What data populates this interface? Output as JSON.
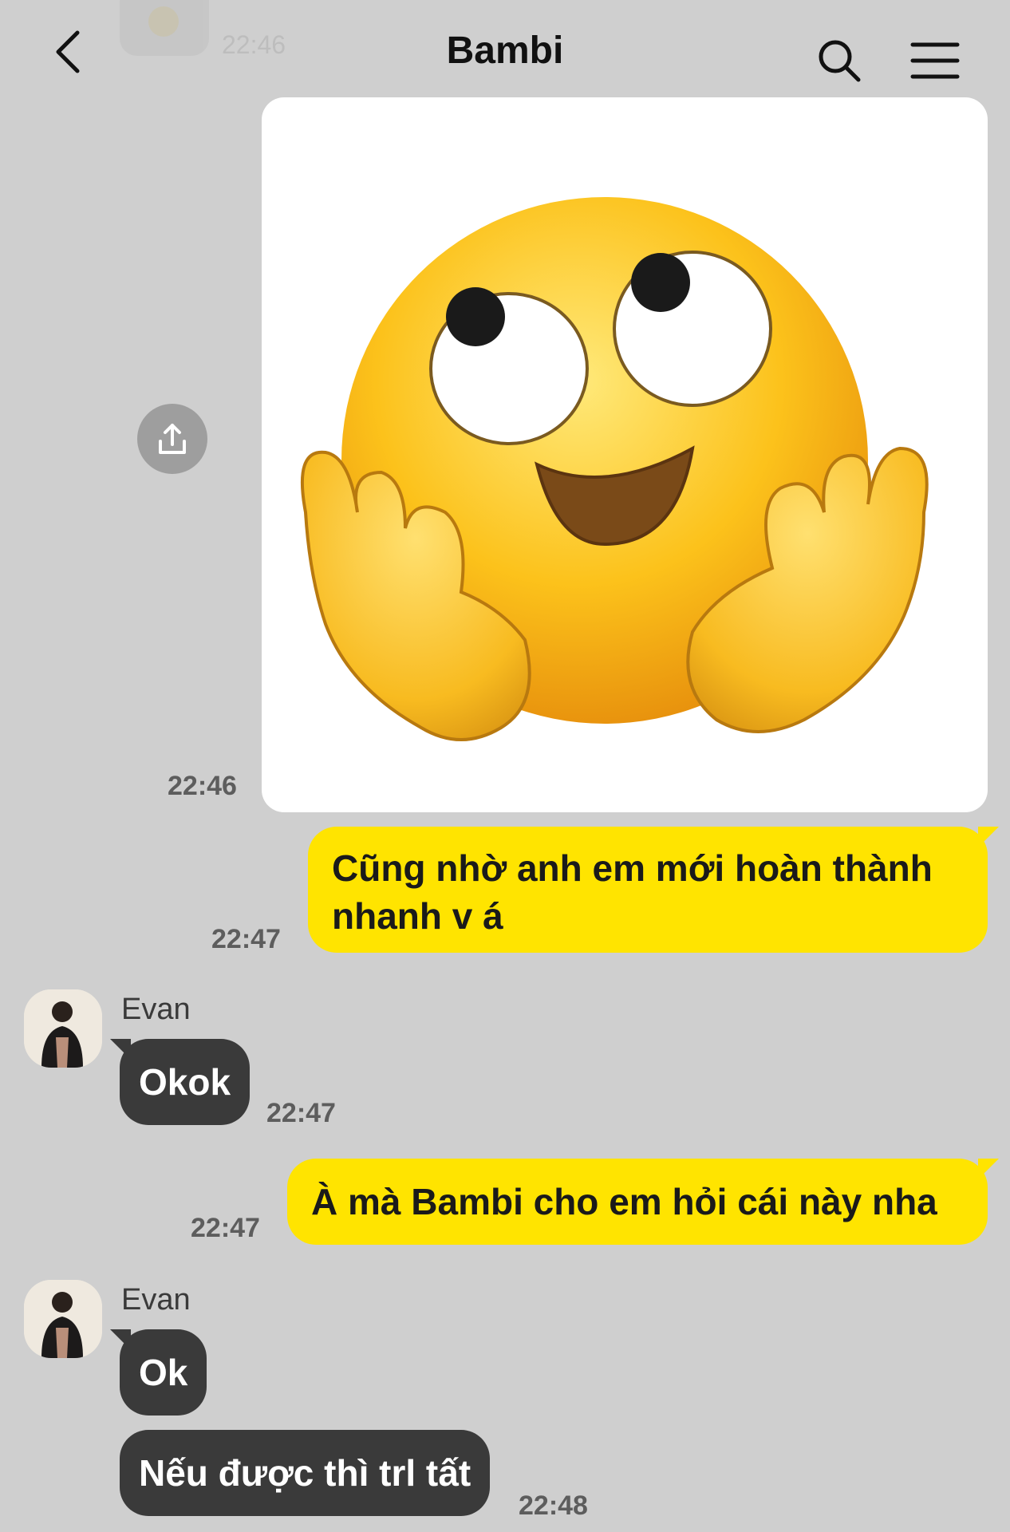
{
  "header": {
    "title": "Bambi"
  },
  "previous_message": {
    "time": "22:46"
  },
  "messages": [
    {
      "id": "m1",
      "kind": "sticker",
      "direction": "out",
      "sticker": "face-with-rolling-eyes-hands-on-cheeks",
      "time": "22:46"
    },
    {
      "id": "m2",
      "kind": "text",
      "direction": "out",
      "lines": [
        "Cũng nhờ anh em mới hoàn thành",
        "nhanh v á"
      ],
      "time": "22:47"
    },
    {
      "id": "m3",
      "kind": "text",
      "direction": "in",
      "sender": "Evan",
      "text": "Okok",
      "time": "22:47"
    },
    {
      "id": "m4",
      "kind": "text",
      "direction": "out",
      "text": "À mà Bambi cho em hỏi cái này nha",
      "time": "22:47"
    },
    {
      "id": "m5",
      "kind": "text",
      "direction": "in",
      "sender": "Evan",
      "text": "Ok"
    },
    {
      "id": "m6",
      "kind": "text",
      "direction": "in",
      "text": "Nếu được thì trl tất",
      "time": "22:48"
    }
  ],
  "colors": {
    "background": "#cfcfcf",
    "outgoing_bubble": "#ffe400",
    "incoming_bubble": "#3a3a3a"
  },
  "icons": [
    "back-icon",
    "search-icon",
    "menu-icon",
    "share-icon"
  ]
}
